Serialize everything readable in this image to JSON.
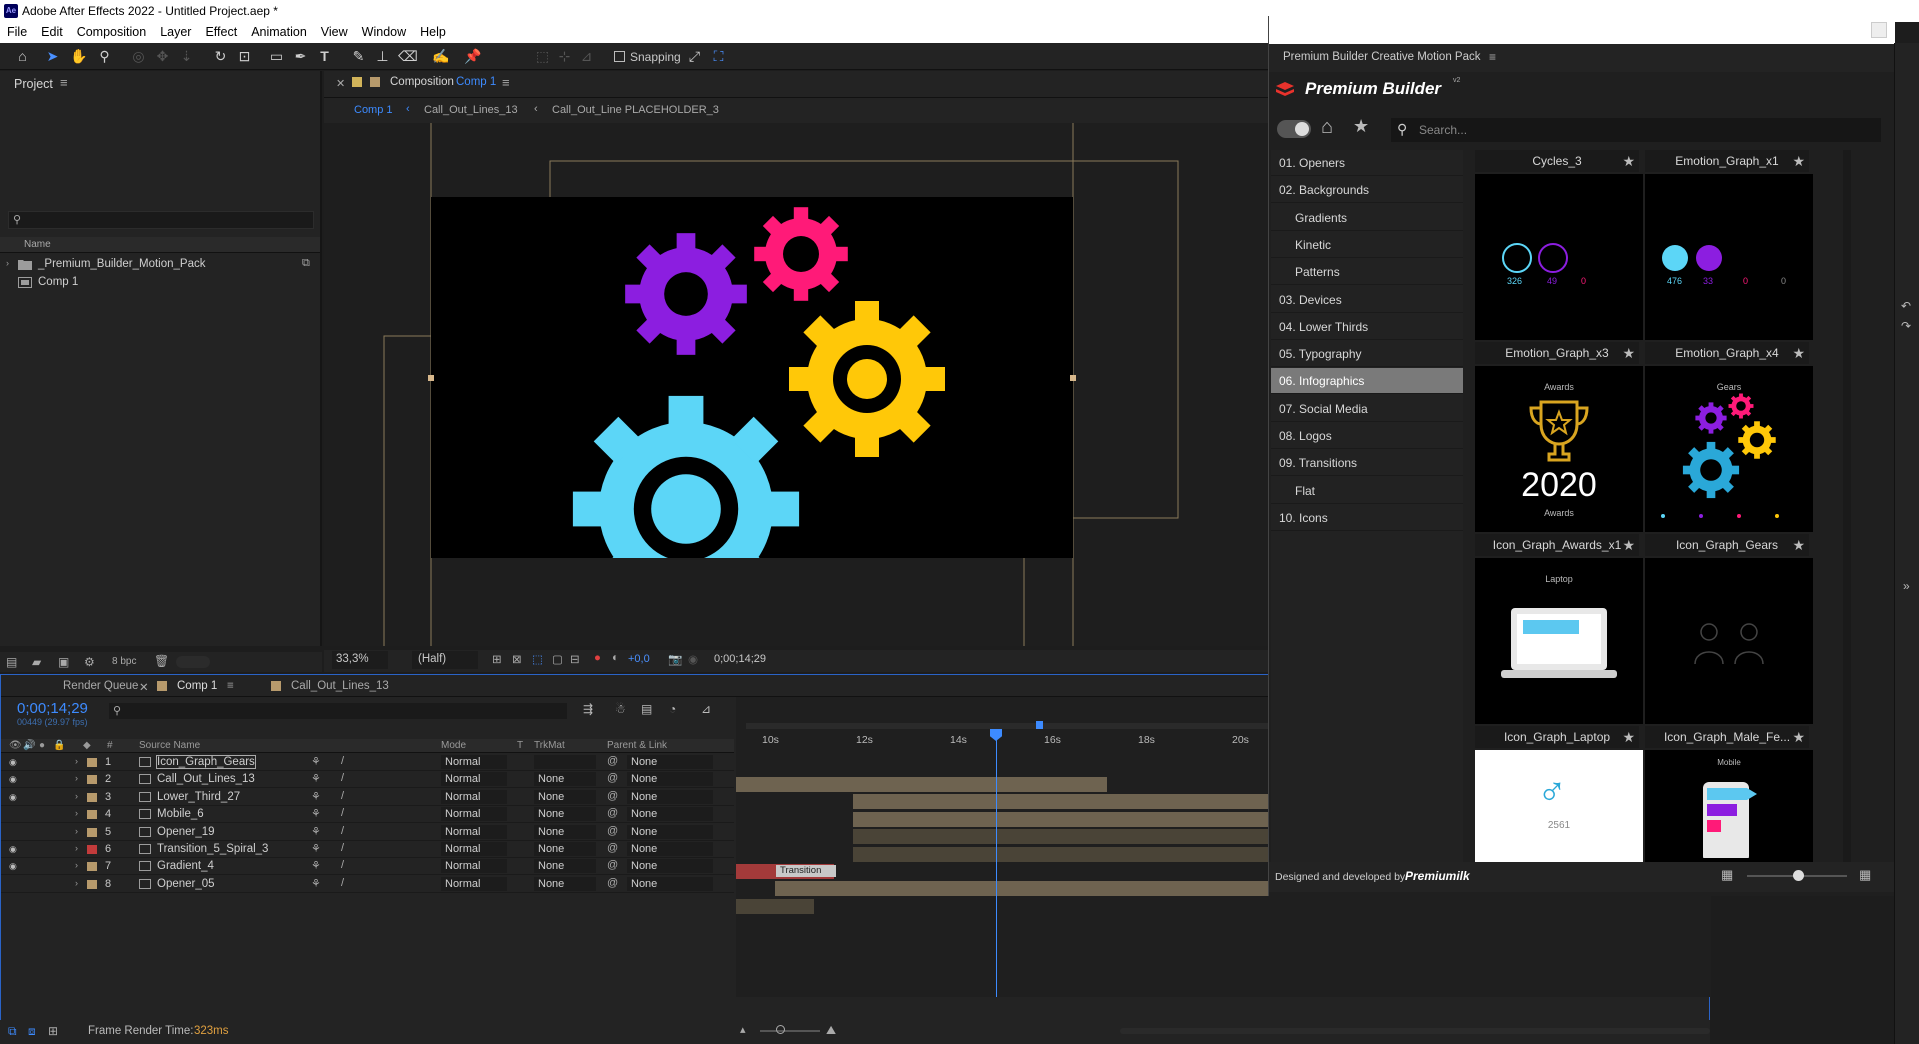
{
  "app": {
    "title": "Adobe After Effects 2022 - Untitled Project.aep *",
    "logo": "Ae",
    "window_controls": {
      "minimize": "—",
      "maximize": "❐",
      "close": "✕"
    }
  },
  "menu": [
    "File",
    "Edit",
    "Composition",
    "Layer",
    "Effect",
    "Animation",
    "View",
    "Window",
    "Help"
  ],
  "toolbar": {
    "snapping_label": "Snapping"
  },
  "project": {
    "title": "Project",
    "column_name": "Name",
    "items": [
      {
        "name": "_Premium_Builder_Motion_Pack",
        "type": "folder"
      },
      {
        "name": "Comp 1",
        "type": "composition"
      }
    ],
    "bpc": "8 bpc"
  },
  "composition": {
    "tab_prefix": "Composition",
    "tab_name": "Comp 1",
    "breadcrumbs": [
      "Comp 1",
      "Call_Out_Lines_13",
      "Call_Out_Line PLACEHOLDER_3"
    ],
    "zoom": "33,3%",
    "resolution": "(Half)",
    "exposure": "+0,0",
    "timecode": "0;00;14;29",
    "gear_colors": {
      "purple": "#8c1ee0",
      "pink": "#ff1a78",
      "yellow": "#ffc808",
      "cyan": "#5cd6f7"
    }
  },
  "timeline": {
    "tabs": [
      "Render Queue",
      "Comp 1",
      "Call_Out_Lines_13"
    ],
    "timecode": "0;00;14;29",
    "fps_info": "00449 (29.97 fps)",
    "columns": {
      "source_name": "Source Name",
      "mode": "Mode",
      "t": "T",
      "trkmat": "TrkMat",
      "parent": "Parent & Link"
    },
    "ruler": [
      "10s",
      "12s",
      "14s",
      "16s",
      "18s",
      "20s"
    ],
    "layers": [
      {
        "num": "1",
        "name": "Icon_Graph_Gears",
        "mode": "Normal",
        "trkmat": "",
        "parent": "None",
        "label": "#b79a6c",
        "visible": true
      },
      {
        "num": "2",
        "name": "Call_Out_Lines_13",
        "mode": "Normal",
        "trkmat": "None",
        "parent": "None",
        "label": "#b79a6c",
        "visible": true
      },
      {
        "num": "3",
        "name": "Lower_Third_27",
        "mode": "Normal",
        "trkmat": "None",
        "parent": "None",
        "label": "#b79a6c",
        "visible": true
      },
      {
        "num": "4",
        "name": "Mobile_6",
        "mode": "Normal",
        "trkmat": "None",
        "parent": "None",
        "label": "#b79a6c",
        "visible": false
      },
      {
        "num": "5",
        "name": "Opener_19",
        "mode": "Normal",
        "trkmat": "None",
        "parent": "None",
        "label": "#b79a6c",
        "visible": false
      },
      {
        "num": "6",
        "name": "Transition_5_Spiral_3",
        "mode": "Normal",
        "trkmat": "None",
        "parent": "None",
        "label": "#c23b3b",
        "visible": true
      },
      {
        "num": "7",
        "name": "Gradient_4",
        "mode": "Normal",
        "trkmat": "None",
        "parent": "None",
        "label": "#b79a6c",
        "visible": true
      },
      {
        "num": "8",
        "name": "Opener_05",
        "mode": "Normal",
        "trkmat": "None",
        "parent": "None",
        "label": "#b79a6c",
        "visible": false
      }
    ],
    "transition_marker": "Transition",
    "status_label": "Frame Render Time:",
    "status_value": "323ms"
  },
  "plugin": {
    "panel_title": "Premium Builder Creative Motion Pack",
    "brand": "Premium Builder",
    "brand_version": "v2",
    "search_placeholder": "Search...",
    "categories": [
      {
        "label": "01. Openers",
        "sub": false,
        "active": false
      },
      {
        "label": "02. Backgrounds",
        "sub": false,
        "active": false
      },
      {
        "label": "Gradients",
        "sub": true,
        "active": false
      },
      {
        "label": "Kinetic",
        "sub": true,
        "active": false
      },
      {
        "label": "Patterns",
        "sub": true,
        "active": false
      },
      {
        "label": "03. Devices",
        "sub": false,
        "active": false
      },
      {
        "label": "04. Lower Thirds",
        "sub": false,
        "active": false
      },
      {
        "label": "05. Typography",
        "sub": false,
        "active": false
      },
      {
        "label": "06. Infographics",
        "sub": false,
        "active": true
      },
      {
        "label": "07. Social Media",
        "sub": false,
        "active": false
      },
      {
        "label": "08. Logos",
        "sub": false,
        "active": false
      },
      {
        "label": "09. Transitions",
        "sub": false,
        "active": false
      },
      {
        "label": "Flat",
        "sub": true,
        "active": false
      },
      {
        "label": "10. Icons",
        "sub": false,
        "active": false
      }
    ],
    "thumb_labels": [
      "Cycles_3",
      "Emotion_Graph_x1",
      "Emotion_Graph_x3",
      "Emotion_Graph_x4",
      "Icon_Graph_Awards_x1",
      "Icon_Graph_Gears",
      "Icon_Graph_Laptop",
      "Icon_Graph_Male_Fe..."
    ],
    "thumb_text": {
      "awards_title": "Awards",
      "awards_year": "2020",
      "awards_sub": "Awards",
      "gears_title": "Gears",
      "laptop_title": "Laptop",
      "male_num": "2561",
      "mobile_title": "Mobile",
      "emo1_a": "326",
      "emo1_b": "49",
      "emo1_c": "0",
      "emo2_a": "476",
      "emo2_b": "33",
      "emo2_c": "0",
      "emo2_d": "0"
    },
    "footer_text": "Designed and developed by",
    "footer_brand": "Premiumilk"
  }
}
